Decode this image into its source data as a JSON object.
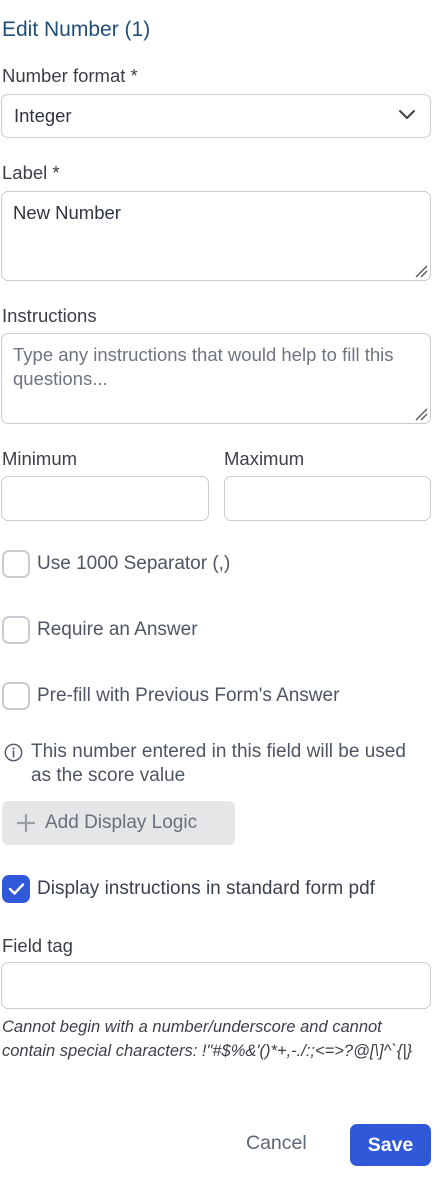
{
  "dialog": {
    "title": "Edit Number (1)"
  },
  "number_format": {
    "label": "Number format *",
    "value": "Integer"
  },
  "label_field": {
    "label": "Label *",
    "value": "New Number"
  },
  "instructions": {
    "label": "Instructions",
    "placeholder": "Type any instructions that would help to fill this questions..."
  },
  "minimum": {
    "label": "Minimum",
    "value": ""
  },
  "maximum": {
    "label": "Maximum",
    "value": ""
  },
  "options": [
    {
      "label": "Use 1000 Separator (,)",
      "checked": false
    },
    {
      "label": "Require an Answer",
      "checked": false
    },
    {
      "label": "Pre-fill with Previous Form's Answer",
      "checked": false
    }
  ],
  "info": {
    "text": "This number entered in this field will be used as the score value",
    "icon": "info-circle-icon"
  },
  "display_logic": {
    "label": "Add Display Logic",
    "icon": "plus-icon"
  },
  "display_instructions": {
    "label": "Display instructions in standard form pdf",
    "checked": true
  },
  "field_tag": {
    "label": "Field tag",
    "value": "",
    "hint": "Cannot begin with a number/underscore and cannot contain special characters: !\"#$%&'()*+,-./:;<=>?@[\\]^`{|}"
  },
  "footer": {
    "cancel_label": "Cancel",
    "save_label": "Save"
  },
  "colors": {
    "accent": "#2f59d9",
    "title": "#1f4e7a",
    "border": "#c9cdd3"
  }
}
